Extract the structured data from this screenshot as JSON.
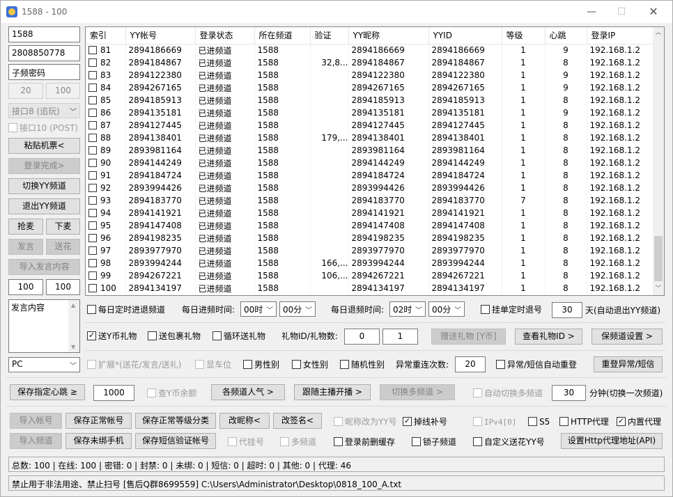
{
  "window": {
    "title": "1588 - 100"
  },
  "left": {
    "channel": "1588",
    "sub_channel": "2808850778",
    "sub_password": "子频密码",
    "range_from": "20",
    "range_to": "100",
    "api_select": "接口8 (追玩)",
    "api10_label": "接口10 (POST)",
    "paste_ticket": "粘贴机票<",
    "login_done": "登录完成>",
    "switch_yy": "切换YY频道",
    "exit_yy": "退出YY频道",
    "grab_mic": "抢麦",
    "release_mic": "下麦",
    "speak": "发言",
    "send_flower": "送花",
    "import_speech": "导入发言内容",
    "speak_from": "100",
    "speak_to": "100",
    "speech_content": "发言内容",
    "platform": "PC"
  },
  "table": {
    "columns": [
      "索引",
      "YY帐号",
      "登录状态",
      "所在频道",
      "验证",
      "YY昵称",
      "YYID",
      "等级",
      "心跳",
      "登录IP"
    ],
    "rows": [
      [
        "81",
        "2894186669",
        "已进频道",
        "1588",
        "",
        "2894186669",
        "2894186669",
        "1",
        "9",
        "192.168.1.2"
      ],
      [
        "82",
        "2894184867",
        "已进频道",
        "1588",
        "32,8...",
        "2894184867",
        "2894184867",
        "1",
        "8",
        "192.168.1.2"
      ],
      [
        "83",
        "2894122380",
        "已进频道",
        "1588",
        "",
        "2894122380",
        "2894122380",
        "1",
        "9",
        "192.168.1.2"
      ],
      [
        "84",
        "2894267165",
        "已进频道",
        "1588",
        "",
        "2894267165",
        "2894267165",
        "1",
        "9",
        "192.168.1.2"
      ],
      [
        "85",
        "2894185913",
        "已进频道",
        "1588",
        "",
        "2894185913",
        "2894185913",
        "1",
        "8",
        "192.168.1.2"
      ],
      [
        "86",
        "2894135181",
        "已进频道",
        "1588",
        "",
        "2894135181",
        "2894135181",
        "1",
        "9",
        "192.168.1.2"
      ],
      [
        "87",
        "2894127445",
        "已进频道",
        "1588",
        "",
        "2894127445",
        "2894127445",
        "1",
        "8",
        "192.168.1.2"
      ],
      [
        "88",
        "2894138401",
        "已进频道",
        "1588",
        "179,...",
        "2894138401",
        "2894138401",
        "1",
        "8",
        "192.168.1.2"
      ],
      [
        "89",
        "2893981164",
        "已进频道",
        "1588",
        "",
        "2893981164",
        "2893981164",
        "1",
        "8",
        "192.168.1.2"
      ],
      [
        "90",
        "2894144249",
        "已进频道",
        "1588",
        "",
        "2894144249",
        "2894144249",
        "1",
        "8",
        "192.168.1.2"
      ],
      [
        "91",
        "2894184724",
        "已进频道",
        "1588",
        "",
        "2894184724",
        "2894184724",
        "1",
        "8",
        "192.168.1.2"
      ],
      [
        "92",
        "2893994426",
        "已进频道",
        "1588",
        "",
        "2893994426",
        "2893994426",
        "1",
        "8",
        "192.168.1.2"
      ],
      [
        "93",
        "2894183770",
        "已进频道",
        "1588",
        "",
        "2894183770",
        "2894183770",
        "7",
        "8",
        "192.168.1.2"
      ],
      [
        "94",
        "2894141921",
        "已进频道",
        "1588",
        "",
        "2894141921",
        "2894141921",
        "1",
        "8",
        "192.168.1.2"
      ],
      [
        "95",
        "2894147408",
        "已进频道",
        "1588",
        "",
        "2894147408",
        "2894147408",
        "1",
        "8",
        "192.168.1.2"
      ],
      [
        "96",
        "2894198235",
        "已进频道",
        "1588",
        "",
        "2894198235",
        "2894198235",
        "1",
        "8",
        "192.168.1.2"
      ],
      [
        "97",
        "2893977970",
        "已进频道",
        "1588",
        "",
        "2893977970",
        "2893977970",
        "1",
        "8",
        "192.168.1.2"
      ],
      [
        "98",
        "2893994244",
        "已进频道",
        "1588",
        "166,...",
        "2893994244",
        "2893994244",
        "1",
        "8",
        "192.168.1.2"
      ],
      [
        "99",
        "2894267221",
        "已进频道",
        "1588",
        "106,...",
        "2894267221",
        "2894267221",
        "1",
        "8",
        "192.168.1.2"
      ],
      [
        "100",
        "2894134197",
        "已进频道",
        "1588",
        "",
        "2894134197",
        "2894134197",
        "1",
        "8",
        "192.168.1.2"
      ]
    ]
  },
  "row1": {
    "daily_enter": "每日定时进退频道",
    "enter_time_label": "每日进频时间:",
    "enter_hour": "00时",
    "enter_min": "00分",
    "exit_time_label": "每日退频时间:",
    "exit_hour": "02时",
    "exit_min": "00分",
    "hang_exit": "挂单定时退号",
    "hang_days": "30",
    "hang_suffix": "天(自动退出YY频道)"
  },
  "row2": {
    "send_ycoin": "送Y币礼物",
    "send_pack": "送包裹礼物",
    "loop_send": "循环送礼物",
    "gift_label": "礼物ID/礼物数:",
    "gift_id": "0",
    "gift_count": "1",
    "gift_btn": "赠送礼物 [Y币]",
    "view_gift": "查看礼物ID >",
    "keep_channel": "保频道设置 >"
  },
  "row3": {
    "extend": "扩展*(送花/发言/送礼)",
    "show_car": "显车位",
    "male": "男性别",
    "female": "女性别",
    "random_gender": "随机性别",
    "relogin_label": "异常重连次数:",
    "relogin_count": "20",
    "auto_relogin": "异常/短信自动重登",
    "relogin_btn": "重登异常/短信"
  },
  "row4": {
    "save_heart": "保存指定心跳 ≥",
    "heart_value": "1000",
    "check_ycoin": "查Y币余额",
    "popularity": "各频道人气 >",
    "follow_anchor": "跟随主播开播 >",
    "switch_multi": "切换多频道 >",
    "auto_switch": "自动切换多频道",
    "switch_minutes": "30",
    "switch_suffix": "分钟(切换一次频道)"
  },
  "row5": {
    "import_account": "导入帐号",
    "save_normal": "保存正常帐号",
    "save_level": "保存正常等级分类",
    "rename": "改昵称<",
    "resign": "改签名<",
    "nick_to_yy": "昵称改为YY号",
    "reconnect": "掉线补号",
    "ipv4": "IPv4[0]",
    "s5": "S5",
    "http_proxy": "HTTP代理",
    "builtin_proxy": "内置代理"
  },
  "row6": {
    "import_channel": "导入频道",
    "save_unbound": "保存未绑手机",
    "save_sms": "保存短信验证帐号",
    "proxy_account": "代挂号",
    "multi_channel": "多频道",
    "clear_cache": "登录前删缓存",
    "lock_channel": "锁子频道",
    "custom_flower": "自定义送花YY号",
    "set_http": "设置Http代理地址(API)"
  },
  "status": "总数: 100  |  在线: 100  |  密错: 0  |  封禁: 0  |  未绑: 0  |  短信: 0  |  超时: 0  |  其他: 0  |  代理: 46",
  "bottom": "禁止用于非法用途、禁止扫号 [售后Q群8699559]  C:\\Users\\Administrator\\Desktop\\0818_100_A.txt"
}
